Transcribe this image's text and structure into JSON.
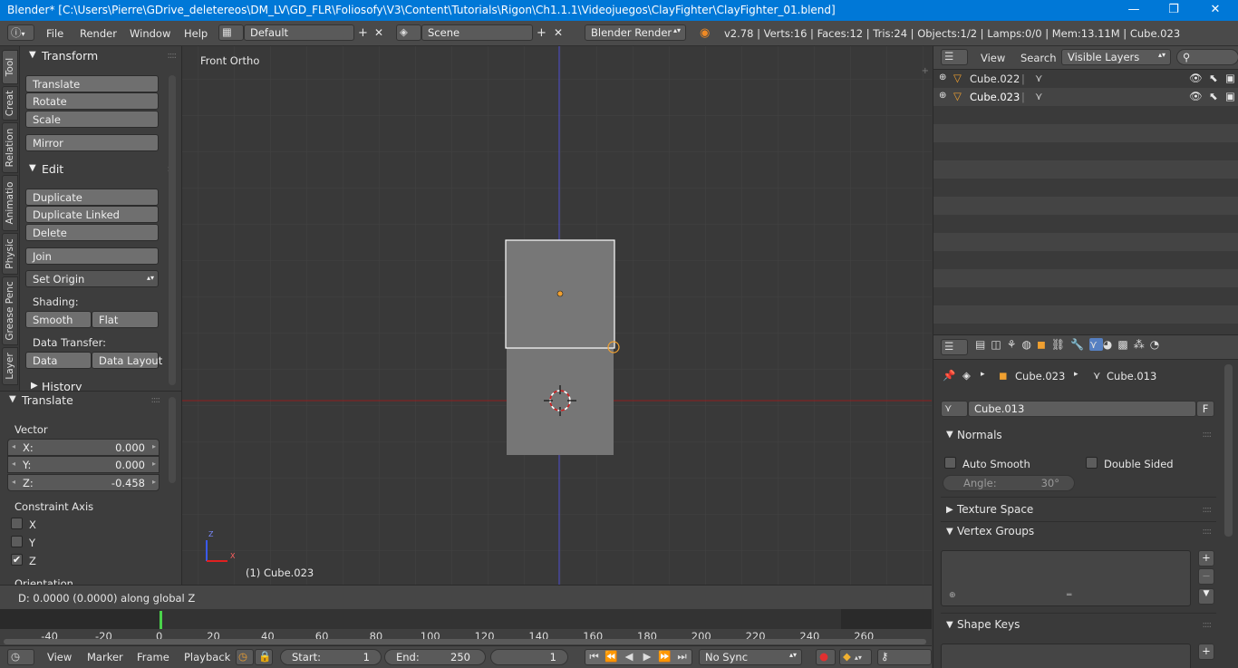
{
  "titlebar": {
    "title": "Blender* [C:\\Users\\Pierre\\GDrive_deletereos\\DM_LV\\GD_FLR\\Foliosofy\\V3\\Content\\Tutorials\\Rigon\\Ch1.1.1\\Videojuegos\\ClayFighter\\ClayFighter_01.blend]",
    "minimize": "—",
    "maximize": "❐",
    "close": "✕"
  },
  "menubar": {
    "menus": [
      "File",
      "Render",
      "Window",
      "Help"
    ],
    "layout": "Default",
    "scene": "Scene",
    "engine": "Blender Render",
    "stats": "v2.78 | Verts:16 | Faces:12 | Tris:24 | Objects:1/2 | Lamps:0/0 | Mem:13.11M | Cube.023"
  },
  "tooltabs": [
    "Tool",
    "Creat",
    "Relation",
    "Animatio",
    "Physic",
    "Grease Penc",
    "Layer"
  ],
  "toolshelf": {
    "transform": {
      "title": "Transform",
      "buttons": [
        "Translate",
        "Rotate",
        "Scale"
      ],
      "mirror": "Mirror"
    },
    "edit": {
      "title": "Edit",
      "buttons": [
        "Duplicate",
        "Duplicate Linked",
        "Delete"
      ],
      "join": "Join",
      "set_origin": "Set Origin",
      "shading_label": "Shading:",
      "smooth": "Smooth",
      "flat": "Flat",
      "data_transfer_label": "Data Transfer:",
      "data": "Data",
      "data_layout": "Data Layout"
    },
    "history": "History"
  },
  "operator": {
    "title": "Translate",
    "vector_label": "Vector",
    "x_label": "X:",
    "x": "0.000",
    "y_label": "Y:",
    "y": "0.000",
    "z_label": "Z:",
    "z": "-0.458",
    "constraint_label": "Constraint Axis",
    "cx": "X",
    "cy": "Y",
    "cz": "Z",
    "cz_checked": true,
    "orientation": "Orientation"
  },
  "viewport": {
    "view_name": "Front Ortho",
    "object_label": "(1) Cube.023",
    "axis_z": "Z",
    "axis_x": "X"
  },
  "status": "D: 0.0000 (0.0000) along global Z",
  "timeline": {
    "ticks": [
      "-40",
      "-20",
      "0",
      "20",
      "40",
      "60",
      "80",
      "100",
      "120",
      "140",
      "160",
      "180",
      "200",
      "220",
      "240",
      "260"
    ],
    "menus": [
      "View",
      "Marker",
      "Frame",
      "Playback"
    ],
    "start": "Start:",
    "start_val": "1",
    "end": "End:",
    "end_val": "250",
    "current": "1",
    "sync": "No Sync"
  },
  "outliner": {
    "menus": [
      "View",
      "Search"
    ],
    "filter": "Visible Layers",
    "items": [
      {
        "name": "Cube.022"
      },
      {
        "name": "Cube.023"
      }
    ]
  },
  "properties": {
    "breadcrumb_object": "Cube.023",
    "breadcrumb_mesh": "Cube.013",
    "mesh_name": "Cube.013",
    "fake_user": "F",
    "normals": "Normals",
    "auto_smooth": "Auto Smooth",
    "double_sided": "Double Sided",
    "angle_label": "Angle:",
    "angle_val": "30°",
    "texture_space": "Texture Space",
    "vertex_groups": "Vertex Groups",
    "shape_keys": "Shape Keys"
  },
  "colors": {
    "accent": "#5680c2",
    "selected_outline": "#ffffff",
    "axis_red": "#b02020",
    "axis_blue": "#5050d0",
    "mesh": "#767676"
  }
}
